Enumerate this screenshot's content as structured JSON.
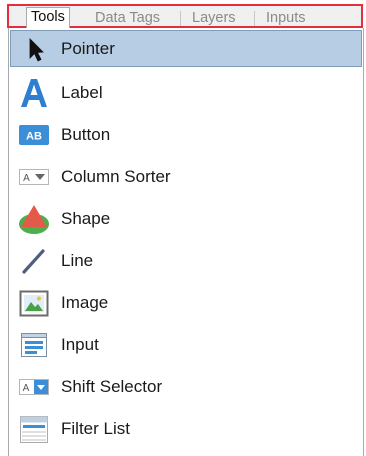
{
  "tabs": [
    {
      "label": "Tools",
      "active": true
    },
    {
      "label": "Data Tags",
      "active": false
    },
    {
      "label": "Layers",
      "active": false
    },
    {
      "label": "Inputs",
      "active": false
    }
  ],
  "tools": [
    {
      "label": "Pointer",
      "icon": "pointer-icon",
      "selected": true
    },
    {
      "label": "Label",
      "icon": "label-icon",
      "selected": false
    },
    {
      "label": "Button",
      "icon": "button-icon",
      "selected": false
    },
    {
      "label": "Column Sorter",
      "icon": "column-sorter-icon",
      "selected": false
    },
    {
      "label": "Shape",
      "icon": "shape-icon",
      "selected": false
    },
    {
      "label": "Line",
      "icon": "line-icon",
      "selected": false
    },
    {
      "label": "Image",
      "icon": "image-icon",
      "selected": false
    },
    {
      "label": "Input",
      "icon": "input-icon",
      "selected": false
    },
    {
      "label": "Shift Selector",
      "icon": "shift-selector-icon",
      "selected": false
    },
    {
      "label": "Filter List",
      "icon": "filter-list-icon",
      "selected": false
    }
  ],
  "colors": {
    "highlight": "#e32f3b",
    "selection": "#b7cde4",
    "accent": "#3a8fd8"
  },
  "button_icon_text": "AB"
}
